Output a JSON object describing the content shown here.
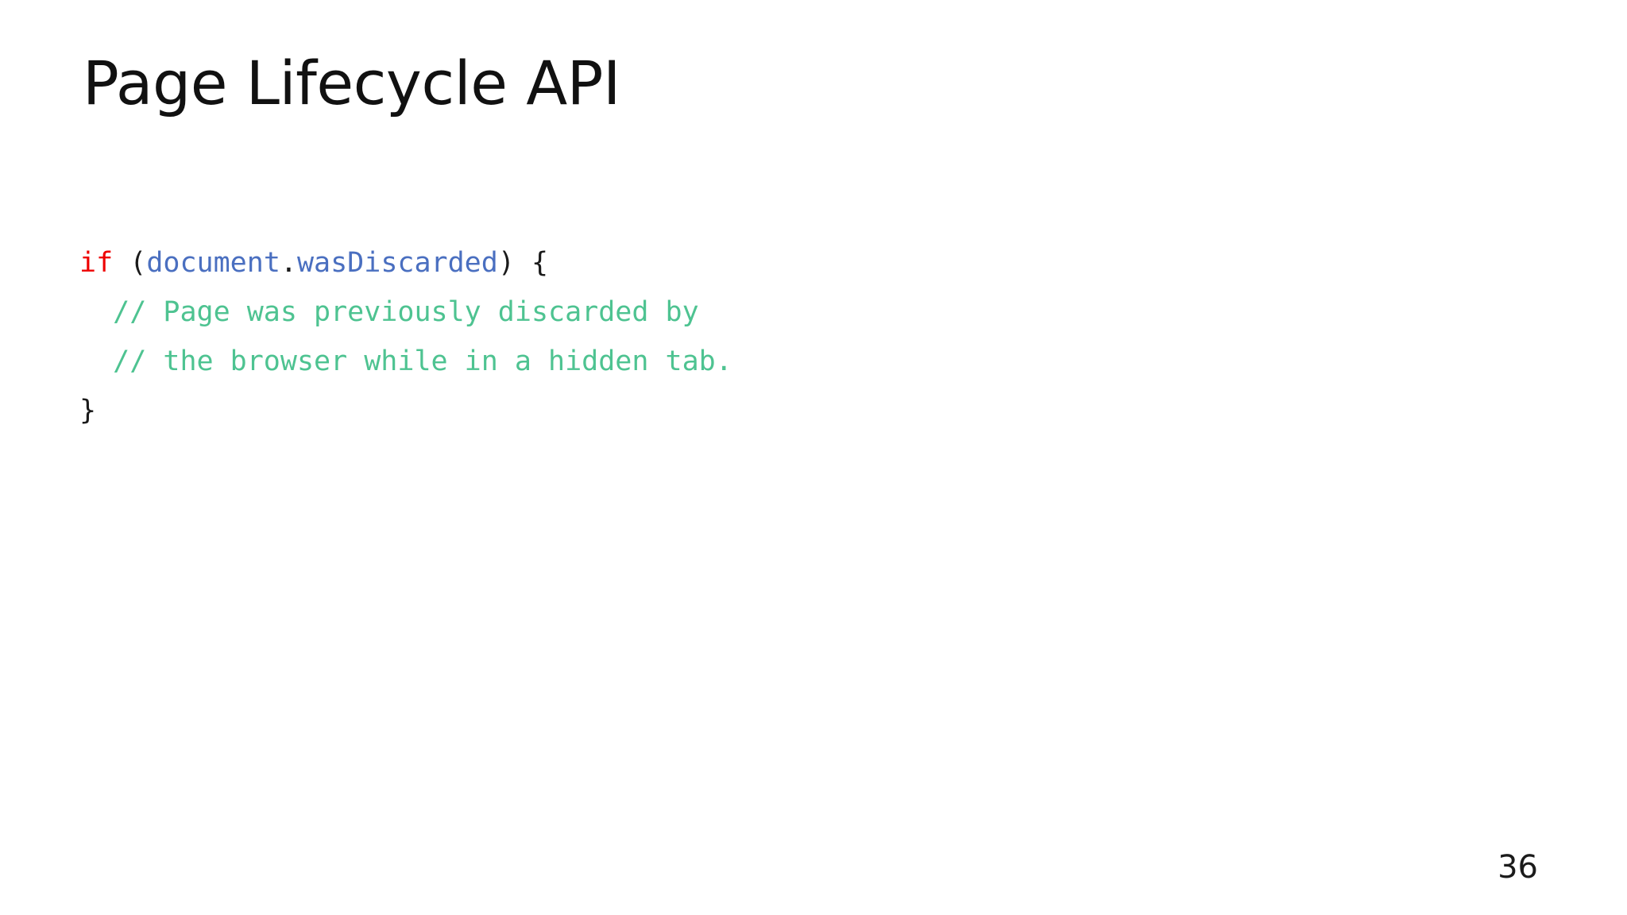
{
  "slide": {
    "title": "Page Lifecycle API",
    "page_number": "36",
    "background_color": "#ffffff"
  },
  "colors": {
    "keyword": "#ee0000",
    "identifier": "#4a6fc0",
    "comment": "#4ec391",
    "punctuation": "#1a1a1a",
    "text": "#111111"
  },
  "code": {
    "language": "javascript",
    "full_text": "if (document.wasDiscarded) {\n  // Page was previously discarded by\n  // the browser while in a hidden tab.\n}",
    "lines": [
      {
        "index": 1,
        "text": "if (document.wasDiscarded) {",
        "tokens": [
          {
            "text": "if",
            "type": "keyword"
          },
          {
            "text": " (",
            "type": "punct"
          },
          {
            "text": "document",
            "type": "ident"
          },
          {
            "text": ".",
            "type": "punct"
          },
          {
            "text": "wasDiscarded",
            "type": "ident"
          },
          {
            "text": ") {",
            "type": "punct"
          }
        ]
      },
      {
        "index": 2,
        "text": "  // Page was previously discarded by",
        "tokens": [
          {
            "text": "  ",
            "type": "plain"
          },
          {
            "text": "// Page was previously discarded by",
            "type": "comment"
          }
        ]
      },
      {
        "index": 3,
        "text": "  // the browser while in a hidden tab.",
        "tokens": [
          {
            "text": "  ",
            "type": "plain"
          },
          {
            "text": "// the browser while in a hidden tab.",
            "type": "comment"
          }
        ]
      },
      {
        "index": 4,
        "text": "}",
        "tokens": [
          {
            "text": "}",
            "type": "punct"
          }
        ]
      }
    ]
  }
}
